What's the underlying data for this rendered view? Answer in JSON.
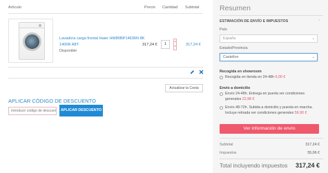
{
  "cart": {
    "columns": {
      "article": "Artículo",
      "price": "Precio",
      "quantity": "Cantidad",
      "subtotal": "Subtotal"
    },
    "item": {
      "name": "Lavadora carga frontal Haier HW80BP14636N 8K 1400R A8T",
      "status": "Disponible",
      "price": "317,24 €",
      "quantity": "1",
      "subtotal": "317,24 €",
      "image_icon": "washing-machine-icon"
    },
    "actions": {
      "edit_icon": "pencil-icon",
      "remove_icon": "close-icon"
    },
    "update_label": "Actualizar la Cesta"
  },
  "discount": {
    "title": "APLICAR CÓDIGO DE DESCUENTO",
    "placeholder": "Introducir código de descuento",
    "button": "APLICAR DESCUENTO"
  },
  "summary": {
    "title": "Resumen",
    "shipping_title": "ESTIMACIÓN DE ENVÍO E IMPUESTOS",
    "country_label": "País",
    "country_value": "España",
    "region_label": "Estado/Provincia",
    "region_value": "Castellon",
    "pickup_title": "Recogida en showroom",
    "pickup_option": "Recogida en tienda en 24-48h",
    "pickup_price": "0,00 €",
    "home_title": "Envío a domicilio",
    "home_option_1": "Envío 24-48h. Entrega en puerta ver condiciones generales",
    "home_option_1_price": "22,98 €",
    "home_option_2": "Envío 48-72h. Subida a domicilio y puesta en marcha. Incluye retirada ver condiciones generales",
    "home_option_2_price": "59,90 €",
    "shipping_button": "Ver información de envío",
    "subtotal_label": "Subtotal",
    "subtotal_value": "317,24 €",
    "tax_label": "Impuestos",
    "tax_value": "55,06 €",
    "total_label": "Total incluyendo impuestos",
    "total_value": "317,24 €"
  },
  "colors": {
    "accent_blue": "#1f8bd6",
    "link_blue": "#2a87c7",
    "cta_red": "#f0586c"
  }
}
